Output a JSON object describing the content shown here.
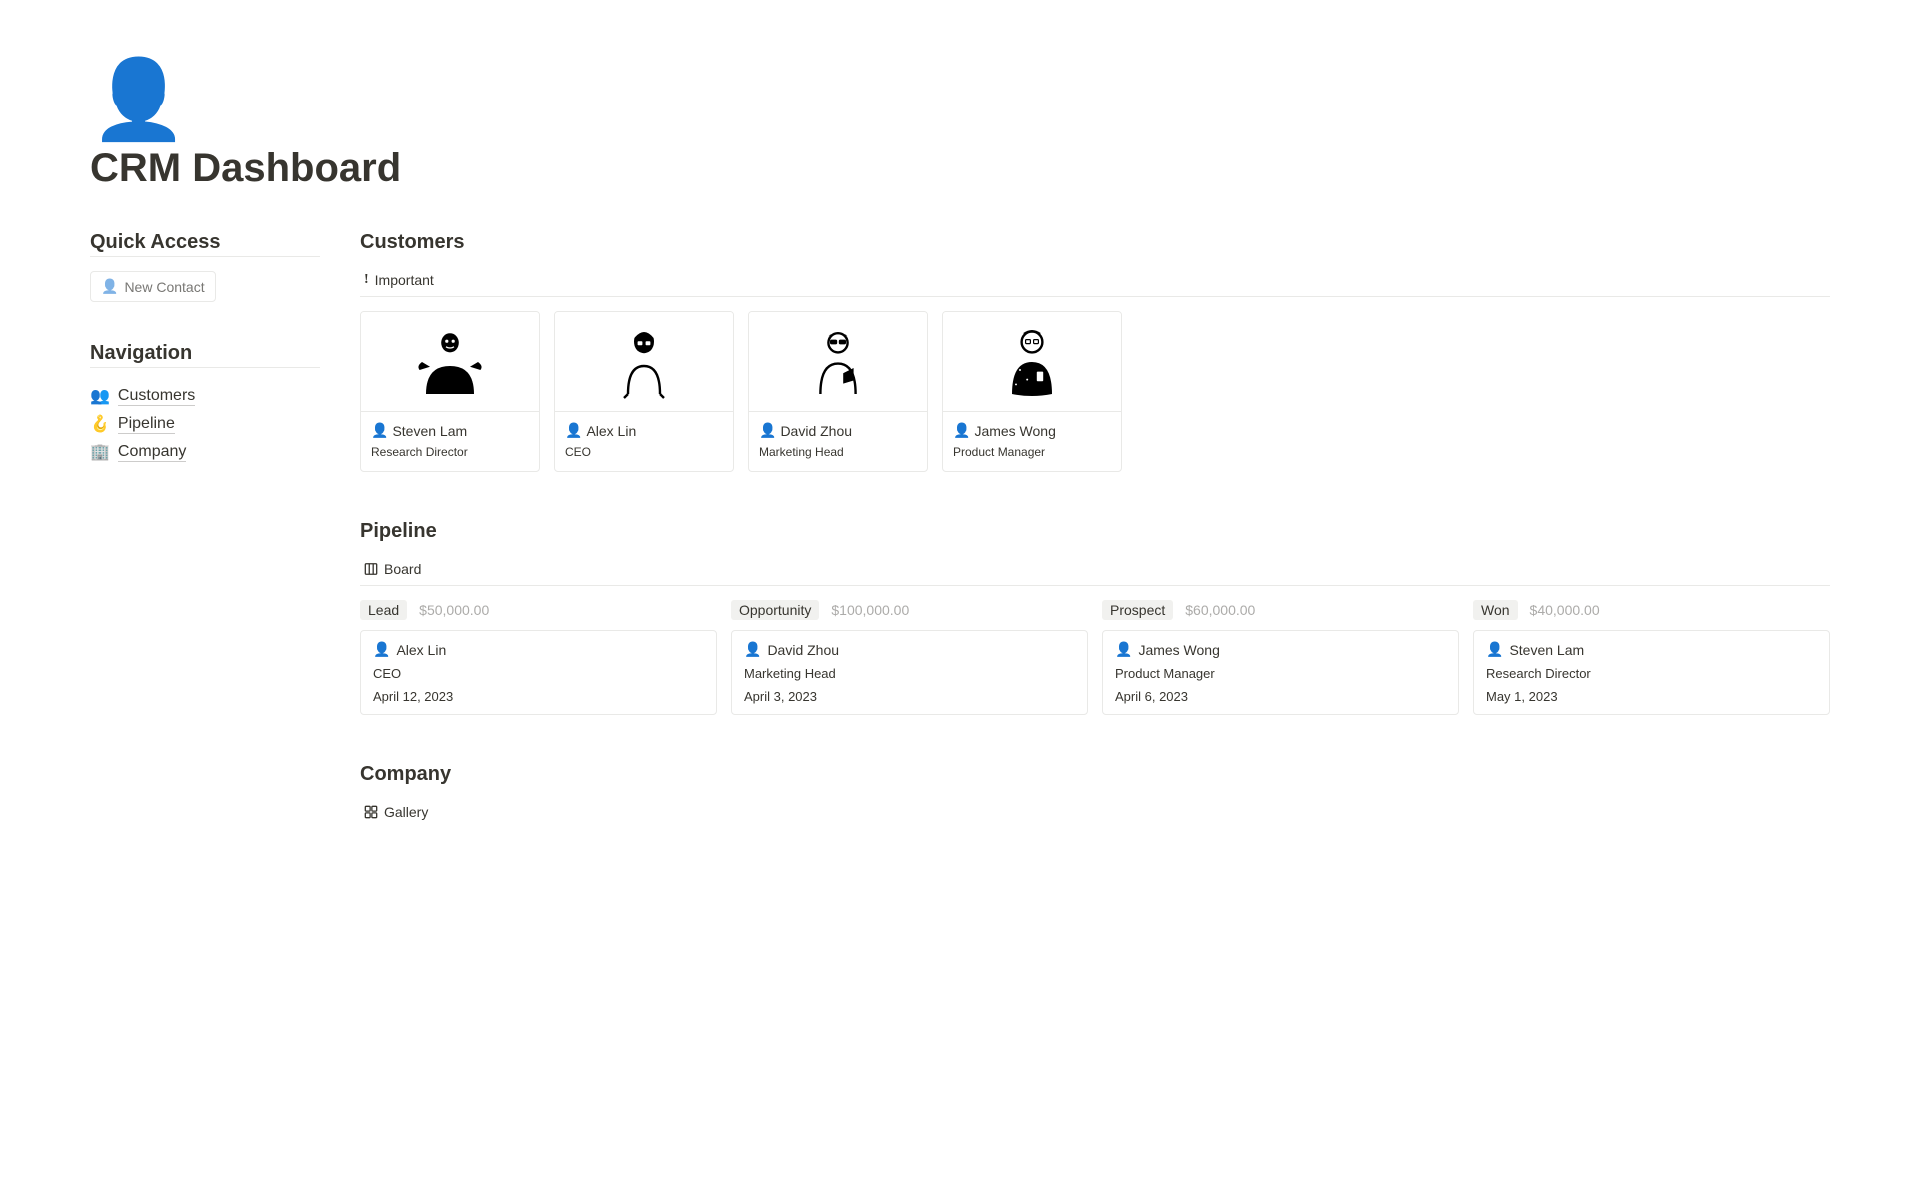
{
  "page": {
    "icon": "👤",
    "title": "CRM Dashboard"
  },
  "quick_access": {
    "heading": "Quick Access",
    "new_contact_label": "New Contact",
    "new_contact_icon": "👤"
  },
  "navigation": {
    "heading": "Navigation",
    "items": [
      {
        "emoji": "👥",
        "label": "Customers"
      },
      {
        "emoji": "🪝",
        "label": "Pipeline"
      },
      {
        "emoji": "🏢",
        "label": "Company"
      }
    ]
  },
  "customers": {
    "heading": "Customers",
    "view_label": "Important",
    "cards": [
      {
        "icon": "👤",
        "name": "Steven Lam",
        "role": "Research Director"
      },
      {
        "icon": "👤",
        "name": "Alex Lin",
        "role": "CEO"
      },
      {
        "icon": "👤",
        "name": "David Zhou",
        "role": "Marketing Head"
      },
      {
        "icon": "👤",
        "name": "James Wong",
        "role": "Product Manager"
      }
    ]
  },
  "pipeline": {
    "heading": "Pipeline",
    "view_label": "Board",
    "columns": [
      {
        "tag": "Lead",
        "amount": "$50,000.00",
        "card": {
          "icon": "👤",
          "name": "Alex Lin",
          "role": "CEO",
          "date": "April 12, 2023"
        }
      },
      {
        "tag": "Opportunity",
        "amount": "$100,000.00",
        "card": {
          "icon": "👤",
          "name": "David Zhou",
          "role": "Marketing Head",
          "date": "April 3, 2023"
        }
      },
      {
        "tag": "Prospect",
        "amount": "$60,000.00",
        "card": {
          "icon": "👤",
          "name": "James Wong",
          "role": "Product Manager",
          "date": "April 6, 2023"
        }
      },
      {
        "tag": "Won",
        "amount": "$40,000.00",
        "card": {
          "icon": "👤",
          "name": "Steven Lam",
          "role": "Research Director",
          "date": "May 1, 2023"
        }
      }
    ]
  },
  "company": {
    "heading": "Company",
    "view_label": "Gallery"
  }
}
